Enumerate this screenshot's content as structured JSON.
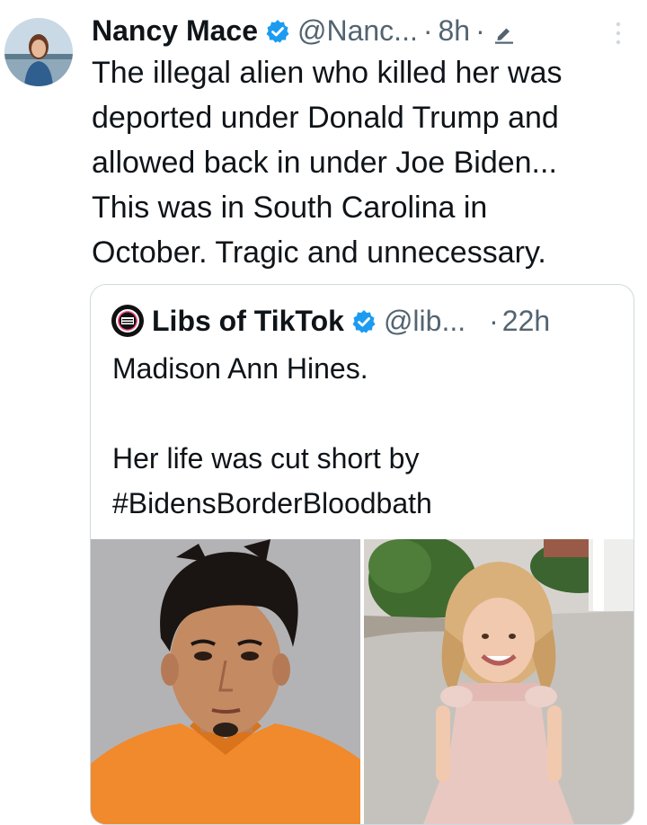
{
  "tweet": {
    "author_name": "Nancy Mace",
    "handle": "@Nanc...",
    "separator": "·",
    "time": "8h",
    "separator2": "·",
    "text_lines": [
      "The illegal alien who killed her was",
      "deported under Donald Trump and",
      "allowed back in under Joe Biden...",
      "This was in South Carolina in",
      "October. Tragic and unnecessary."
    ]
  },
  "quote": {
    "author_name": "Libs of TikTok",
    "handle": "@lib...",
    "separator": "·",
    "time": "22h",
    "text_lines": [
      "Madison Ann Hines.",
      "",
      "Her life was cut short by",
      "#BidensBorderBloodbath"
    ],
    "logo_text": "Libs of TikTok"
  },
  "icons": {
    "verified": "verified-badge-icon",
    "edit": "edit-pencil-icon",
    "more": "more-vertical-icon"
  },
  "colors": {
    "verified_blue": "#1d9bf0",
    "secondary_text": "#536471",
    "border": "#cfd9de"
  }
}
